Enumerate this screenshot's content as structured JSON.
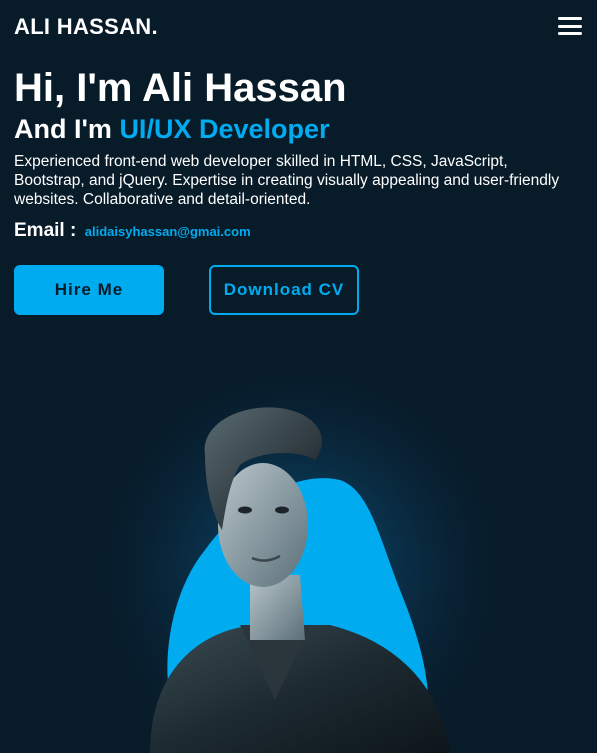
{
  "header": {
    "logo": "ALI HASSAN.",
    "menu_icon": "hamburger-menu-icon"
  },
  "hero": {
    "greeting": "Hi, I'm Ali Hassan",
    "role_prefix": "And I'm",
    "role": "UI/UX Developer",
    "description": "Experienced front-end web developer skilled in HTML, CSS, JavaScript, Bootstrap, and jQuery. Expertise in creating visually appealing and user-friendly websites. Collaborative and detail-oriented.",
    "email_label": "Email :",
    "email": "alidaisyhassan@gmai.com"
  },
  "buttons": {
    "hire": "Hire Me",
    "download": "Download CV"
  },
  "colors": {
    "background": "#081b29",
    "accent": "#00abf0",
    "text": "#ffffff"
  }
}
